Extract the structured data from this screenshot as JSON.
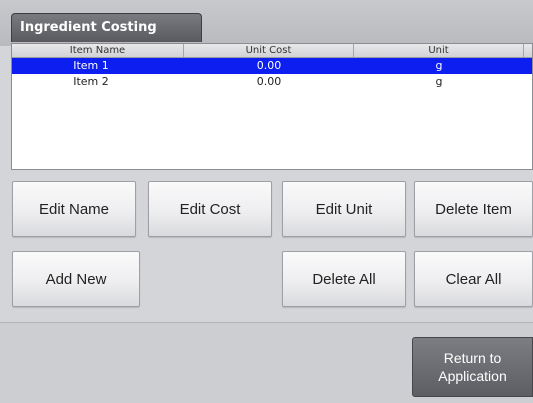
{
  "header": {
    "title": "Ingredient Costing"
  },
  "table": {
    "columns": [
      "Item Name",
      "Unit Cost",
      "Unit"
    ],
    "rows": [
      {
        "name": "Item 1",
        "cost": "0.00",
        "unit": "g",
        "selected": true
      },
      {
        "name": "Item 2",
        "cost": "0.00",
        "unit": "g",
        "selected": false
      }
    ]
  },
  "buttons": {
    "edit_name": "Edit Name",
    "edit_cost": "Edit Cost",
    "edit_unit": "Edit Unit",
    "delete_item": "Delete Item",
    "add_new": "Add New",
    "delete_all": "Delete All",
    "clear_all": "Clear All",
    "return_line1": "Return to",
    "return_line2": "Application"
  },
  "colors": {
    "selection": "#0c1ef0",
    "background": "#d4d5d9"
  }
}
